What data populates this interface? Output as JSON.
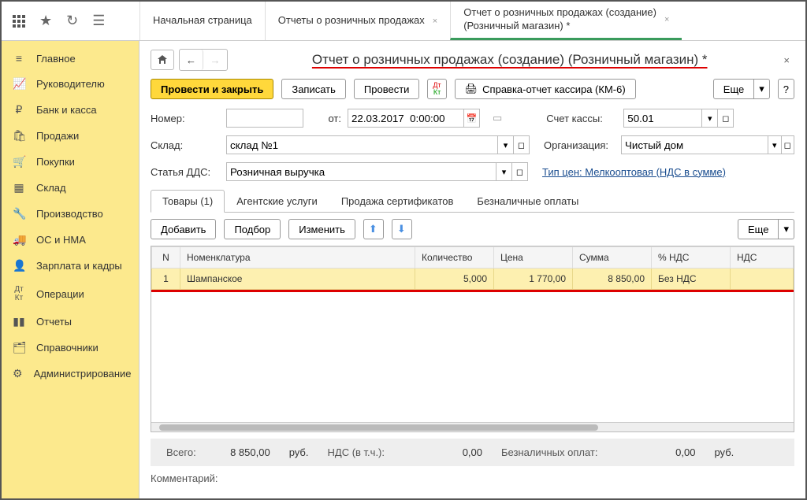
{
  "topTabs": {
    "home": "Начальная страница",
    "reports": "Отчеты о розничных продажах",
    "current": "Отчет о розничных продажах (создание)\n(Розничный магазин) *"
  },
  "sidebar": [
    {
      "label": "Главное"
    },
    {
      "label": "Руководителю"
    },
    {
      "label": "Банк и касса"
    },
    {
      "label": "Продажи"
    },
    {
      "label": "Покупки"
    },
    {
      "label": "Склад"
    },
    {
      "label": "Производство"
    },
    {
      "label": "ОС и НМА"
    },
    {
      "label": "Зарплата и кадры"
    },
    {
      "label": "Операции"
    },
    {
      "label": "Отчеты"
    },
    {
      "label": "Справочники"
    },
    {
      "label": "Администрирование"
    }
  ],
  "pageTitle": "Отчет о розничных продажах (создание) (Розничный магазин) *",
  "toolbar": {
    "postClose": "Провести и закрыть",
    "save": "Записать",
    "post": "Провести",
    "km6": "Справка-отчет кассира (КМ-6)",
    "more": "Еще",
    "help": "?"
  },
  "form": {
    "numberLabel": "Номер:",
    "number": "",
    "fromLabel": "от:",
    "date": "22.03.2017  0:00:00",
    "accountLabel": "Счет кассы:",
    "account": "50.01",
    "warehouseLabel": "Склад:",
    "warehouse": "склад №1",
    "orgLabel": "Организация:",
    "org": "Чистый дом",
    "ddsLabel": "Статья ДДС:",
    "dds": "Розничная выручка",
    "priceTypeLink": "Тип цен: Мелкооптовая (НДС в сумме)"
  },
  "subtabs": {
    "goods": "Товары (1)",
    "agent": "Агентские услуги",
    "certs": "Продажа сертификатов",
    "cashless": "Безналичные оплаты"
  },
  "tabToolbar": {
    "add": "Добавить",
    "pick": "Подбор",
    "edit": "Изменить",
    "more": "Еще"
  },
  "table": {
    "headers": {
      "n": "N",
      "item": "Номенклатура",
      "qty": "Количество",
      "price": "Цена",
      "sum": "Сумма",
      "vatPct": "% НДС",
      "vat": "НДС"
    },
    "rows": [
      {
        "n": "1",
        "item": "Шампанское",
        "qty": "5,000",
        "price": "1 770,00",
        "sum": "8 850,00",
        "vatPct": "Без НДС",
        "vat": ""
      }
    ]
  },
  "totals": {
    "totalLabel": "Всего:",
    "total": "8 850,00",
    "curr": "руб.",
    "vatIncLabel": "НДС (в т.ч.):",
    "vatInc": "0,00",
    "cashlessLabel": "Безналичных оплат:",
    "cashless": "0,00"
  },
  "commentLabel": "Комментарий:"
}
